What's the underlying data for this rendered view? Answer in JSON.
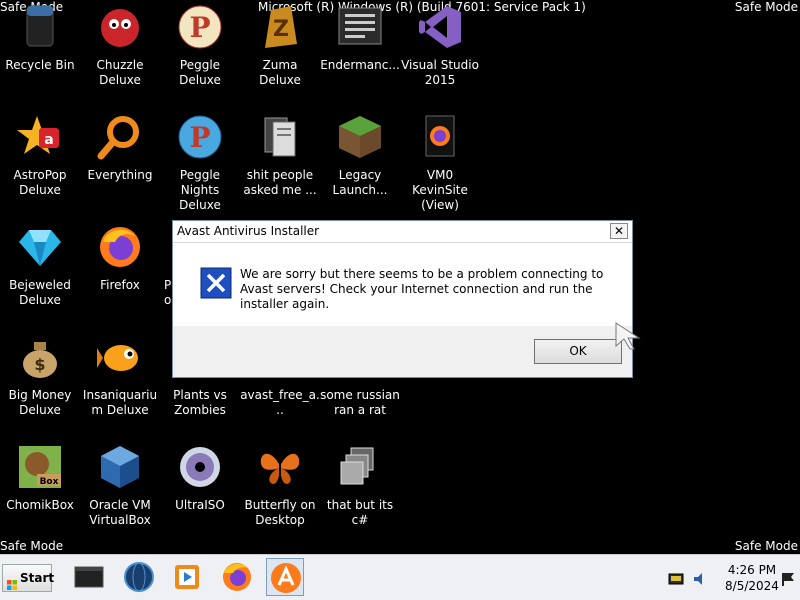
{
  "watermark": {
    "top_left": "Safe Mode",
    "top_right": "Safe Mode",
    "bottom_left": "Safe Mode",
    "bottom_right": "Safe Mode",
    "build": "Microsoft (R) Windows (R) (Build 7601: Service Pack 1)"
  },
  "desktop_icons": [
    {
      "label": "Recycle Bin",
      "icon": "recycle-bin-icon"
    },
    {
      "label": "Chuzzle Deluxe",
      "icon": "chuzzle-icon"
    },
    {
      "label": "Peggle Deluxe",
      "icon": "peggle-icon"
    },
    {
      "label": "Zuma Deluxe",
      "icon": "zuma-icon"
    },
    {
      "label": "Endermanc...",
      "icon": "text-file-icon"
    },
    {
      "label": "Visual Studio 2015",
      "icon": "visual-studio-icon"
    },
    {
      "label": "AstroPop Deluxe",
      "icon": "astropop-icon"
    },
    {
      "label": "Everything",
      "icon": "magnifier-icon"
    },
    {
      "label": "Peggle Nights Deluxe",
      "icon": "peggle-nights-icon"
    },
    {
      "label": "shit people asked me ...",
      "icon": "folder-icon"
    },
    {
      "label": "Legacy Launch...",
      "icon": "minecraft-icon"
    },
    {
      "label": "VM0 KevinSite (View)",
      "icon": "firefox-doc-icon"
    },
    {
      "label": "Bejeweled Deluxe",
      "icon": "gem-icon"
    },
    {
      "label": "Firefox",
      "icon": "firefox-icon"
    },
    {
      "label": "Big Money Deluxe",
      "icon": "money-bag-icon"
    },
    {
      "label": "Insaniquarium Deluxe",
      "icon": "fish-icon"
    },
    {
      "label": "Plants vs Zombies",
      "icon": "plants-vs-zombies-icon"
    },
    {
      "label": "avast_free_a...",
      "icon": "avast-installer-icon"
    },
    {
      "label": "some russian ran a rat",
      "icon": "generic-file-icon"
    },
    {
      "label": "ChomikBox",
      "icon": "chomikbox-icon"
    },
    {
      "label": "Oracle VM VirtualBox",
      "icon": "virtualbox-icon"
    },
    {
      "label": "UltraISO",
      "icon": "disc-icon"
    },
    {
      "label": "Butterfly on Desktop",
      "icon": "butterfly-icon"
    },
    {
      "label": "that but its c#",
      "icon": "shortcut-stack-icon"
    }
  ],
  "partial_icon_text": {
    "line1": "P",
    "line2": "o"
  },
  "dialog": {
    "title": "Avast Antivirus Installer",
    "close": "✕",
    "message": "We are sorry but there seems to be a problem connecting to Avast servers! Check your Internet connection and run the installer again.",
    "ok_label": "OK",
    "icon": "error-x-icon"
  },
  "taskbar": {
    "start_label": "Start",
    "buttons": [
      "terminal-icon",
      "globe-icon",
      "media-player-icon",
      "firefox-icon",
      "avast-icon"
    ],
    "active_index": 4,
    "clock_time": "4:26 PM",
    "clock_date": "8/5/2024",
    "tray_icons": [
      "network-icon",
      "volume-icon",
      "flag-icon"
    ]
  },
  "colors": {
    "desktop_bg": "#000000",
    "taskbar_bg": "#eef0f3",
    "dialog_footer": "#f0f0f0",
    "error_icon_blue": "#1f4fbf"
  }
}
